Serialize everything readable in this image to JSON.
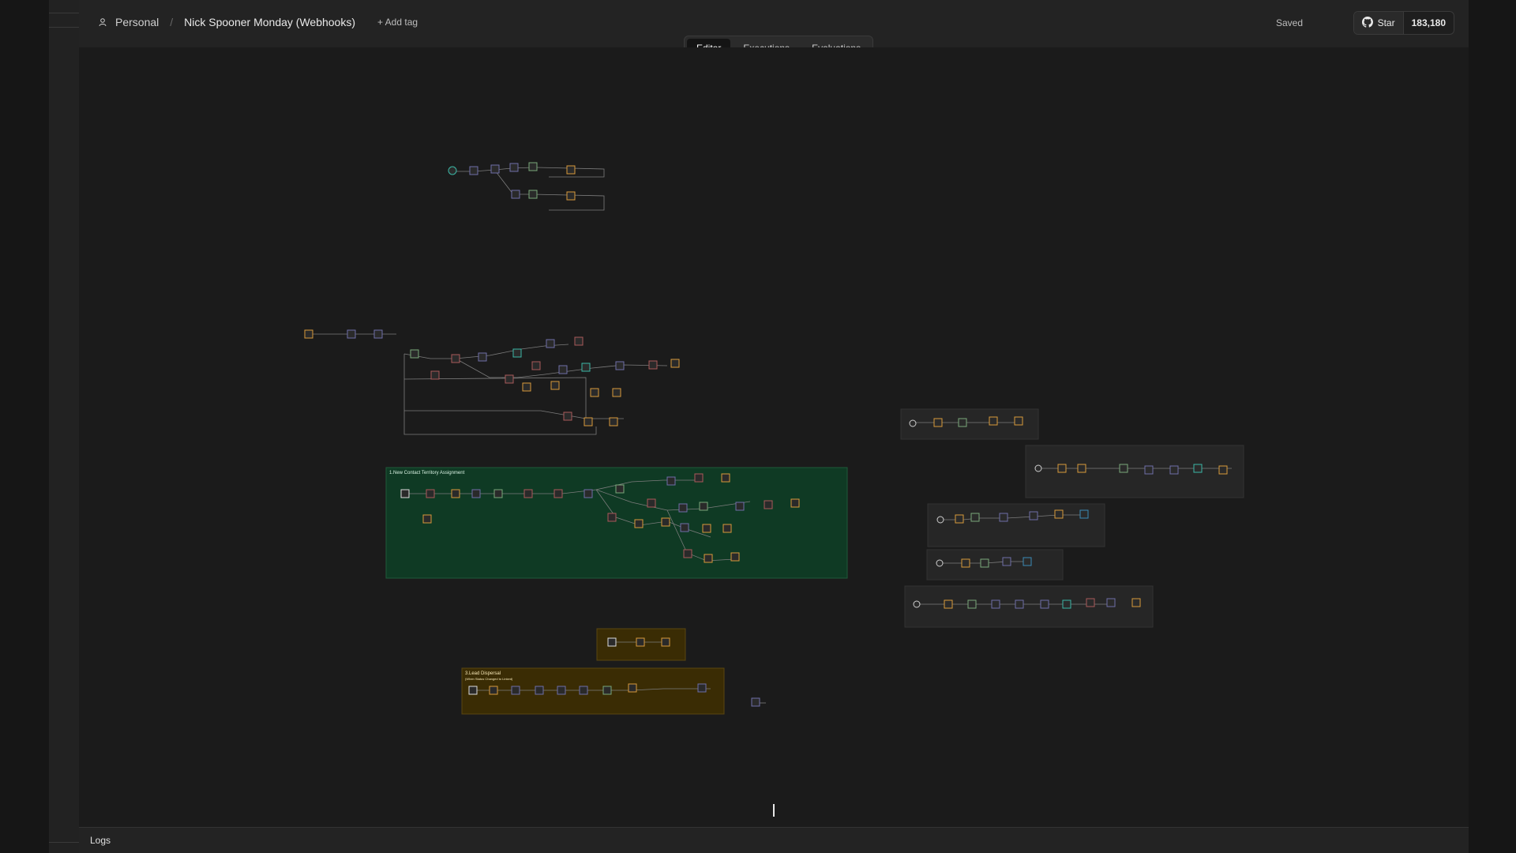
{
  "breadcrumb": {
    "owner": "Personal",
    "workflow_title": "Nick Spooner Monday (Webhooks)",
    "add_tag_label": "+ Add tag"
  },
  "status": {
    "saved": "Saved"
  },
  "github": {
    "star_label": "Star",
    "star_count": "183,180"
  },
  "tabs": [
    {
      "label": "Editor",
      "active": true
    },
    {
      "label": "Executions",
      "active": false
    },
    {
      "label": "Evaluations",
      "active": false
    }
  ],
  "canvas": {
    "groups": [
      {
        "title": "1.New Contact Territory Assignment",
        "color": "#0f3a24"
      },
      {
        "title": "3.Lead Dispersal",
        "subtitle": "(When Status Changed to Linked)",
        "color": "#3a2c04"
      }
    ]
  },
  "footer": {
    "logs_label": "Logs"
  },
  "icons": {
    "user": "user-icon",
    "github": "github-icon"
  },
  "colors": {
    "canvas_bg": "#1b1b1b",
    "group_green": "#0f3a24",
    "group_yellow": "#3a2c04",
    "node_fill": "#2a2a2a",
    "node_stroke": "#5a5a5a",
    "edge": "#7c7c7c"
  }
}
